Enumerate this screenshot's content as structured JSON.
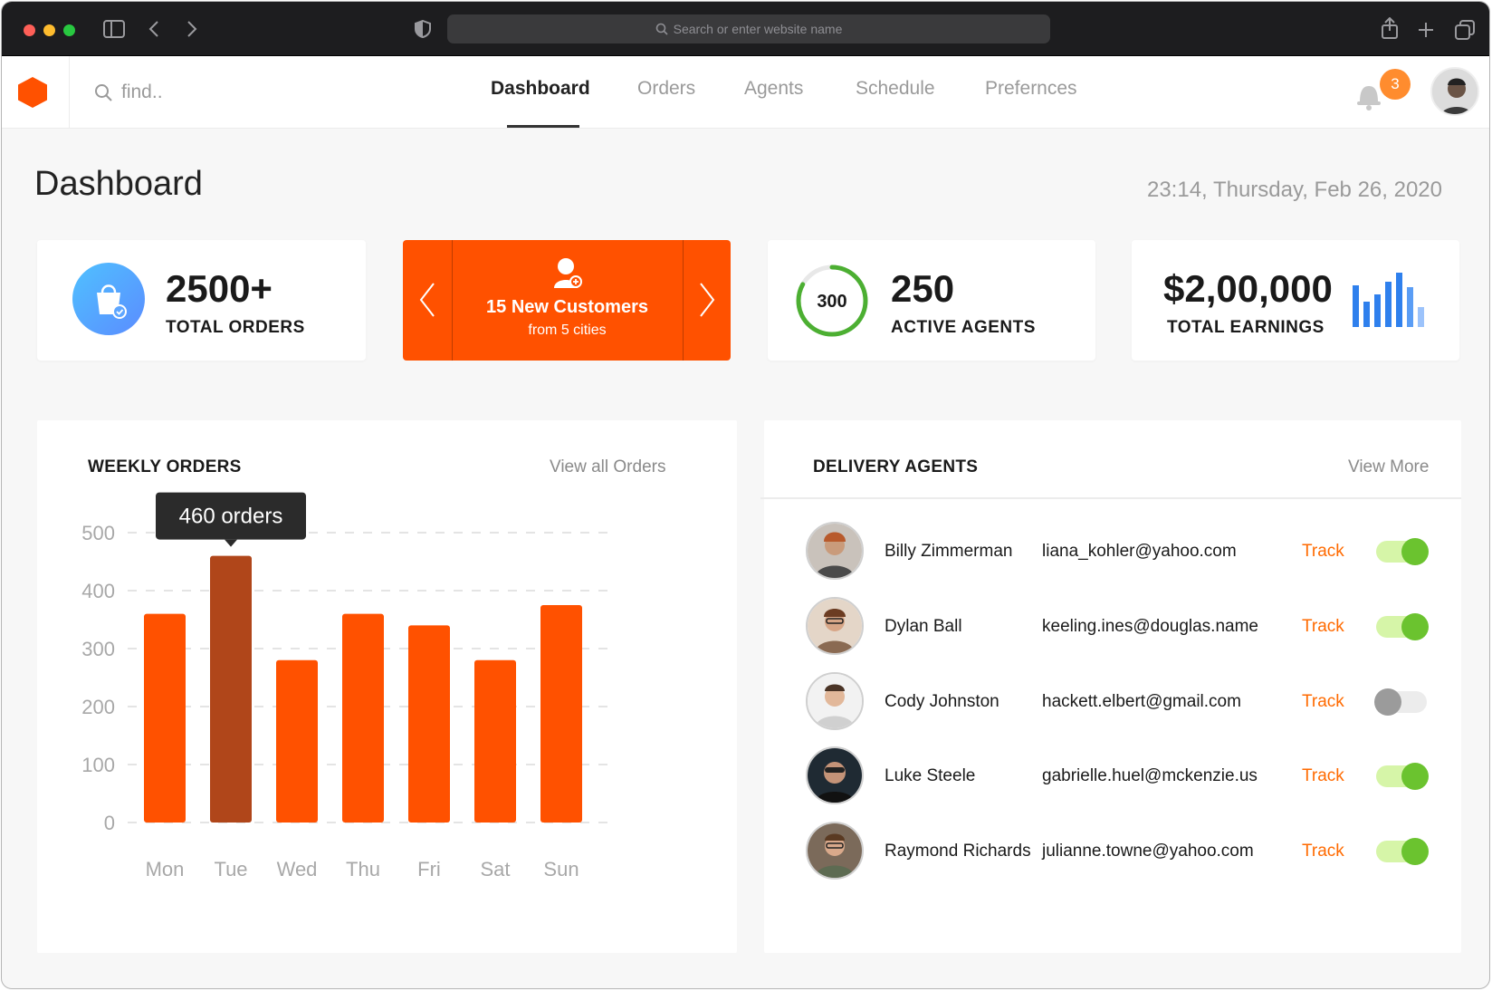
{
  "browser": {
    "address_placeholder": "Search or enter website name"
  },
  "topnav": {
    "search_placeholder": "find..",
    "items": [
      {
        "label": "Dashboard",
        "active": true
      },
      {
        "label": "Orders",
        "active": false
      },
      {
        "label": "Agents",
        "active": false
      },
      {
        "label": "Schedule",
        "active": false
      },
      {
        "label": "Prefernces",
        "active": false
      }
    ],
    "notification_count": "3",
    "accent_color": "#ff5100"
  },
  "page": {
    "title": "Dashboard",
    "datetime": "23:14, Thursday, Feb 26, 2020"
  },
  "stats": {
    "orders": {
      "value": "2500+",
      "label": "TOTAL ORDERS",
      "icon": "shopping-bag-icon"
    },
    "customers": {
      "title": "15 New Customers",
      "subtitle": "from 5 cities",
      "icon": "user-add-icon"
    },
    "agents": {
      "ring_value": "300",
      "value": "250",
      "label": "ACTIVE AGENTS",
      "ring_fraction": 0.83
    },
    "earnings": {
      "value": "$2,00,000",
      "label": "TOTAL EARNINGS",
      "icon": "bar-chart-icon"
    }
  },
  "weekly_orders": {
    "title": "WEEKLY ORDERS",
    "link": "View all Orders",
    "tooltip": "460 orders",
    "highlight_index": 1
  },
  "chart_data": {
    "type": "bar",
    "categories": [
      "Mon",
      "Tue",
      "Wed",
      "Thu",
      "Fri",
      "Sat",
      "Sun"
    ],
    "values": [
      360,
      460,
      280,
      360,
      340,
      280,
      375
    ],
    "ylim": [
      0,
      500
    ],
    "yticks": [
      0,
      100,
      200,
      300,
      400,
      500
    ],
    "title": "",
    "xlabel": "",
    "ylabel": "",
    "bar_color": "#ff5100",
    "highlight_color": "#b0461a",
    "grid": true
  },
  "delivery_agents": {
    "title": "DELIVERY AGENTS",
    "link": "View More",
    "track_label": "Track",
    "rows": [
      {
        "name": "Billy Zimmerman",
        "email": "liana_kohler@yahoo.com",
        "active": true
      },
      {
        "name": "Dylan Ball",
        "email": "keeling.ines@douglas.name",
        "active": true
      },
      {
        "name": "Cody Johnston",
        "email": "hackett.elbert@gmail.com",
        "active": false
      },
      {
        "name": "Luke Steele",
        "email": "gabrielle.huel@mckenzie.us",
        "active": true
      },
      {
        "name": "Raymond Richards",
        "email": "julianne.towne@yahoo.com",
        "active": true
      }
    ]
  }
}
